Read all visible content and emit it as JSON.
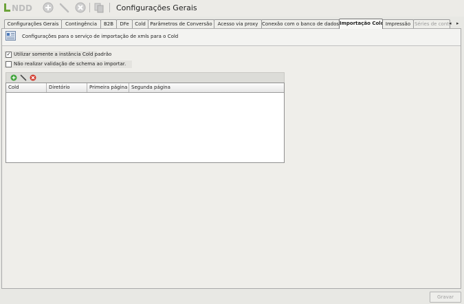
{
  "app": {
    "logo_text": "NDD",
    "title": "Configurações Gerais"
  },
  "toolbar": {
    "icons": [
      "add-icon",
      "edit-icon",
      "delete-icon",
      "copy-icon"
    ]
  },
  "tabs": [
    "Configurações Gerais",
    "Contingência",
    "B2B",
    "DFe",
    "Cold",
    "Parâmetros de Conversão",
    "Acesso via proxy",
    "Conexão com o banco de dados",
    "Importação Cold",
    "Impressão",
    "Séries de cont"
  ],
  "active_tab": "Importação Cold",
  "header": {
    "text": "Configurações para o serviço de importação de xmls para o Cold"
  },
  "options": {
    "use_default_instance": {
      "label": "Utilizar somente a instância Cold padrão",
      "checked": true
    },
    "skip_schema_validation": {
      "label": "Não realizar validação de schema ao importar.",
      "checked": false
    }
  },
  "grid": {
    "columns": [
      "Cold",
      "Diretório",
      "Primeira página",
      "Segunda página"
    ],
    "rows": []
  },
  "footer": {
    "save_label": "Gravar"
  }
}
